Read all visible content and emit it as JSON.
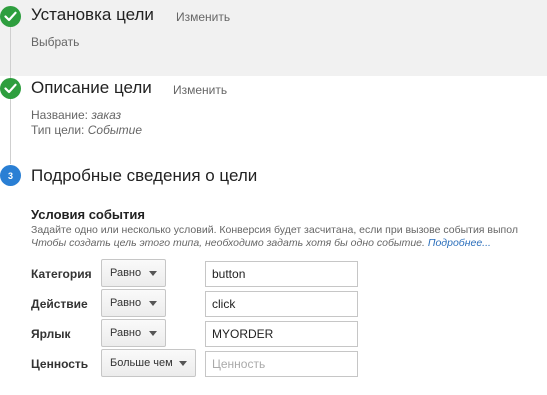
{
  "steps": [
    {
      "title": "Установка цели",
      "edit": "Изменить",
      "detail": "Выбрать"
    },
    {
      "title": "Описание цели",
      "edit": "Изменить",
      "name_label": "Название:",
      "name_value": "заказ",
      "type_label": "Тип цели:",
      "type_value": "Событие"
    },
    {
      "number": "3",
      "title": "Подробные сведения о цели"
    }
  ],
  "conditions": {
    "title": "Условия события",
    "help": "Задайте одно или несколько условий. Конверсия будет засчитана, если при вызове события выпол",
    "hint": "Чтобы создать цель этого типа, необходимо задать хотя бы одно событие.",
    "more_link": "Подробнее...",
    "rows": [
      {
        "label": "Категория",
        "operator": "Равно",
        "value": "button",
        "placeholder": ""
      },
      {
        "label": "Действие",
        "operator": "Равно",
        "value": "click",
        "placeholder": ""
      },
      {
        "label": "Ярлык",
        "operator": "Равно",
        "value": "MYORDER",
        "placeholder": ""
      },
      {
        "label": "Ценность",
        "operator": "Больше чем",
        "value": "",
        "placeholder": "Ценность"
      }
    ]
  },
  "colors": {
    "done": "#2e9e3e",
    "active": "#2a7fd4",
    "link": "#2a6ebb",
    "band": "#f1f1f1"
  },
  "icons": {
    "done": "checkmark-icon",
    "dropdown": "chevron-down-icon"
  }
}
